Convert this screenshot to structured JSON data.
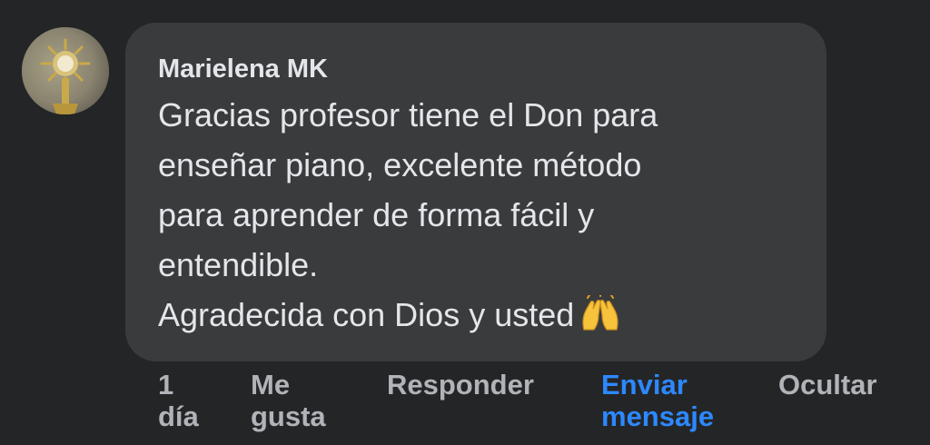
{
  "comment": {
    "author": "Marielena MK",
    "text_lines": [
      "Gracias profesor tiene el Don para",
      "enseñar piano, excelente método",
      "para aprender de forma fácil y",
      "entendible.",
      "Agradecida con Dios y usted"
    ],
    "emoji": "raising-hands-emoji",
    "avatar_icon": "profile-avatar"
  },
  "actions": {
    "time": [
      "1",
      "día"
    ],
    "like": [
      "Me",
      "gusta"
    ],
    "reply": "Responder",
    "send_message": [
      "Enviar",
      "mensaje"
    ],
    "hide": "Ocultar"
  },
  "colors": {
    "background": "#242526",
    "bubble": "#3a3b3c",
    "text": "#e4e6eb",
    "secondary": "#b0b3b8",
    "link_blue": "#2d88ff"
  }
}
